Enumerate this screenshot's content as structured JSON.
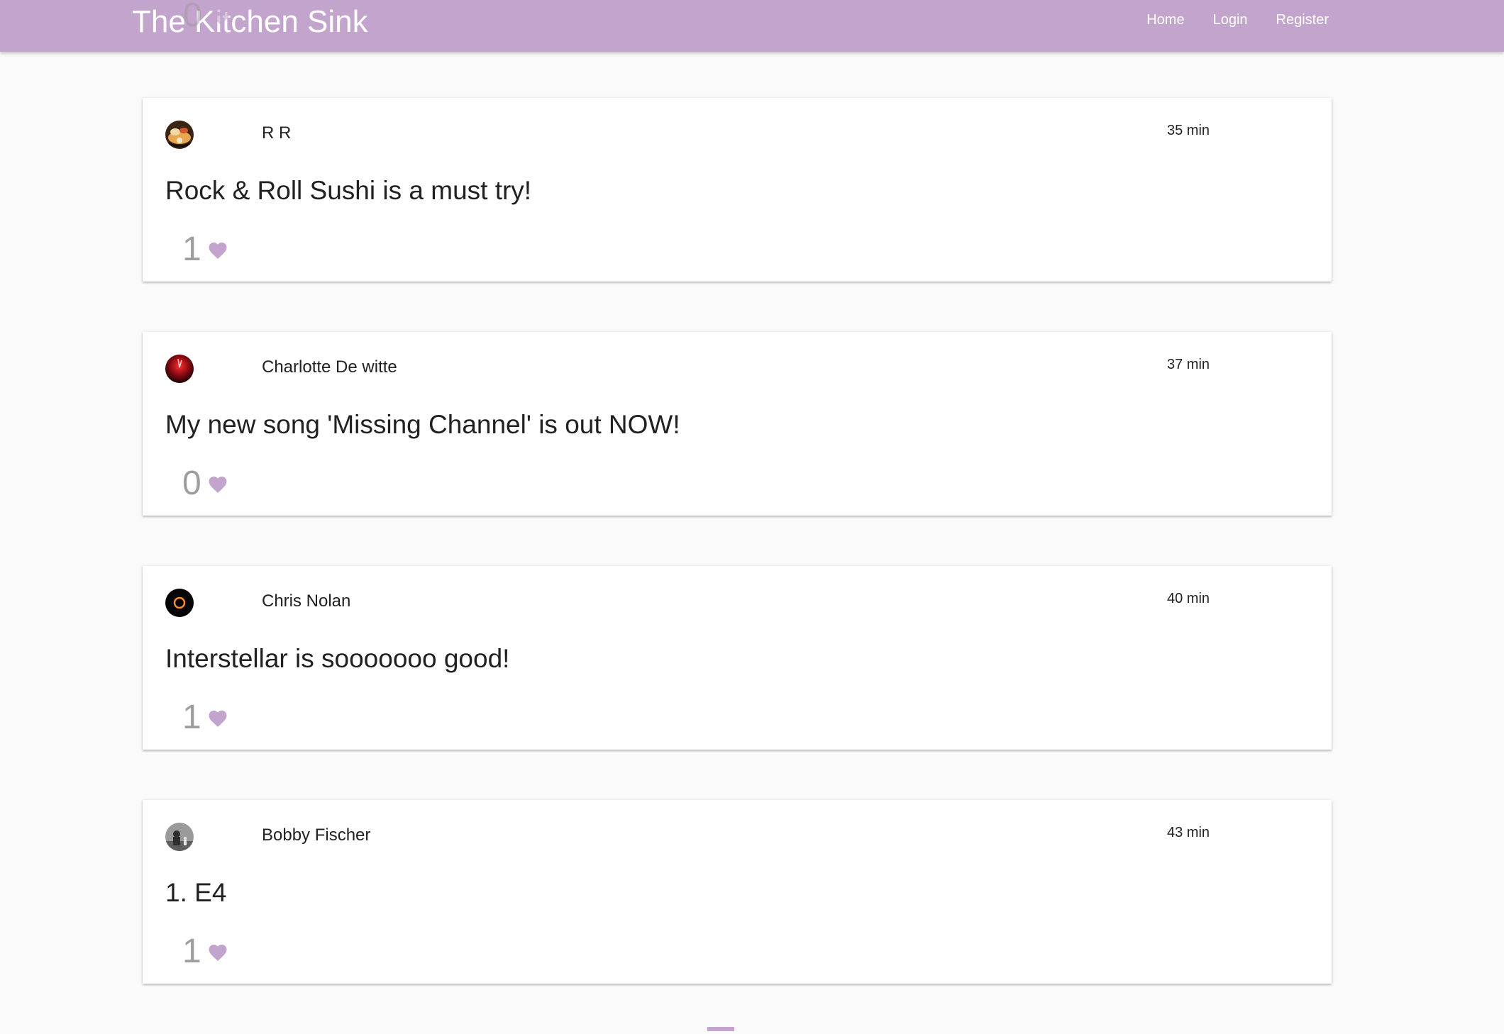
{
  "navbar": {
    "brand": "The Kitchen Sink",
    "links": [
      "Home",
      "Login",
      "Register"
    ]
  },
  "ghost_post": {
    "likes": "0"
  },
  "posts": [
    {
      "author": "R R",
      "time": "35 min",
      "text": "Rock & Roll Sushi is a must try!",
      "likes": "1",
      "avatar": "sushi-photo"
    },
    {
      "author": "Charlotte De witte",
      "time": "37 min",
      "text": "My new song 'Missing Channel' is out NOW!",
      "likes": "0",
      "avatar": "red-concert-photo"
    },
    {
      "author": "Chris Nolan",
      "time": "40 min",
      "text": "Interstellar is sooooooo good!",
      "likes": "1",
      "avatar": "black-hole-photo"
    },
    {
      "author": "Bobby Fischer",
      "time": "43 min",
      "text": "1. E4",
      "likes": "1",
      "avatar": "chess-photo"
    }
  ],
  "colors": {
    "accent": "#c3a4cc",
    "text": "#212121",
    "muted": "#9e9e9e"
  }
}
